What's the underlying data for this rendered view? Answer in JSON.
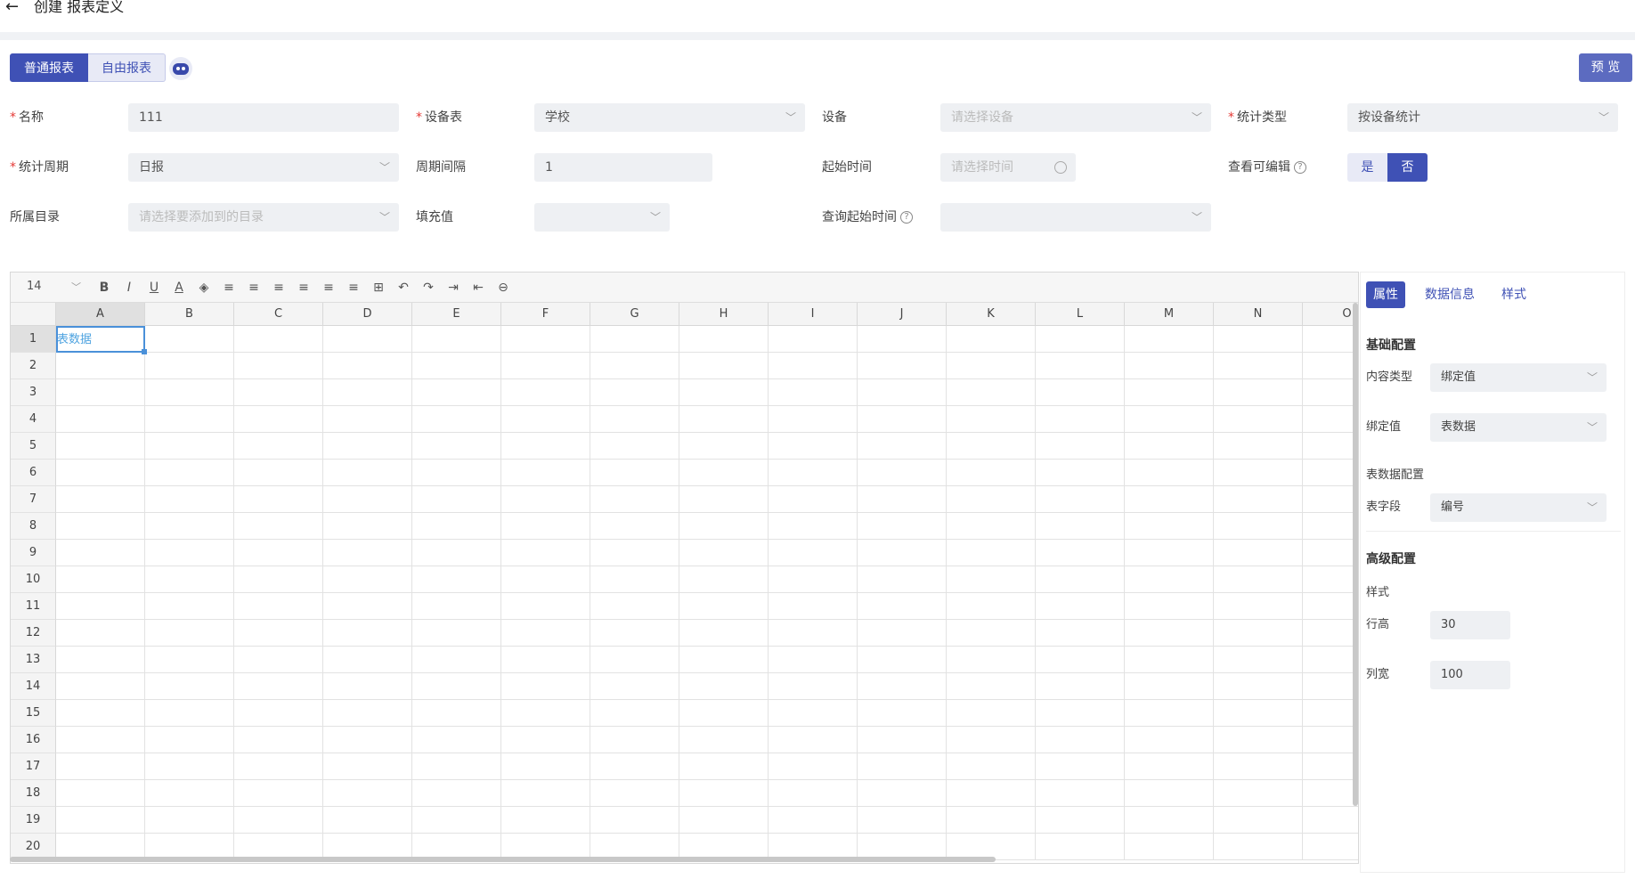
{
  "header": {
    "title": "创建 报表定义"
  },
  "tabs": [
    {
      "label": "普通报表",
      "active": true
    },
    {
      "label": "自由报表",
      "active": false
    }
  ],
  "preview_label": "预 览",
  "form": {
    "name_label": "名称",
    "name_value": "111",
    "device_table_label": "设备表",
    "device_table_value": "学校",
    "device_label": "设备",
    "device_placeholder": "请选择设备",
    "stat_type_label": "统计类型",
    "stat_type_value": "按设备统计",
    "stat_period_label": "统计周期",
    "stat_period_value": "日报",
    "interval_label": "周期间隔",
    "interval_value": "1",
    "start_time_label": "起始时间",
    "start_time_placeholder": "请选择时间",
    "editable_label": "查看可编辑",
    "editable_yes": "是",
    "editable_no": "否",
    "catalog_label": "所属目录",
    "catalog_placeholder": "请选择要添加到的目录",
    "fill_label": "填充值",
    "fill_value": "",
    "query_start_label": "查询起始时间",
    "query_start_value": ""
  },
  "sheet": {
    "font_size": "14",
    "columns": [
      "A",
      "B",
      "C",
      "D",
      "E",
      "F",
      "G",
      "H",
      "I",
      "J",
      "K",
      "L",
      "M",
      "N",
      "O"
    ],
    "rows": [
      "1",
      "2",
      "3",
      "4",
      "5",
      "6",
      "7",
      "8",
      "9",
      "10",
      "11",
      "12",
      "13",
      "14",
      "15",
      "16",
      "17",
      "18",
      "19",
      "20"
    ],
    "cell_a1": "表数据"
  },
  "panel": {
    "tabs": [
      "属性",
      "数据信息",
      "样式"
    ],
    "basic_title": "基础配置",
    "content_type_label": "内容类型",
    "content_type_value": "绑定值",
    "bind_label": "绑定值",
    "bind_value": "表数据",
    "table_config_label": "表数据配置",
    "field_label": "表字段",
    "field_value": "编号",
    "advanced_title": "高级配置",
    "style_label": "样式",
    "row_height_label": "行高",
    "row_height_value": "30",
    "col_width_label": "列宽",
    "col_width_value": "100"
  },
  "colors": {
    "primary": "#3f51b5",
    "required": "#e53935",
    "selection": "#4a90d9"
  }
}
